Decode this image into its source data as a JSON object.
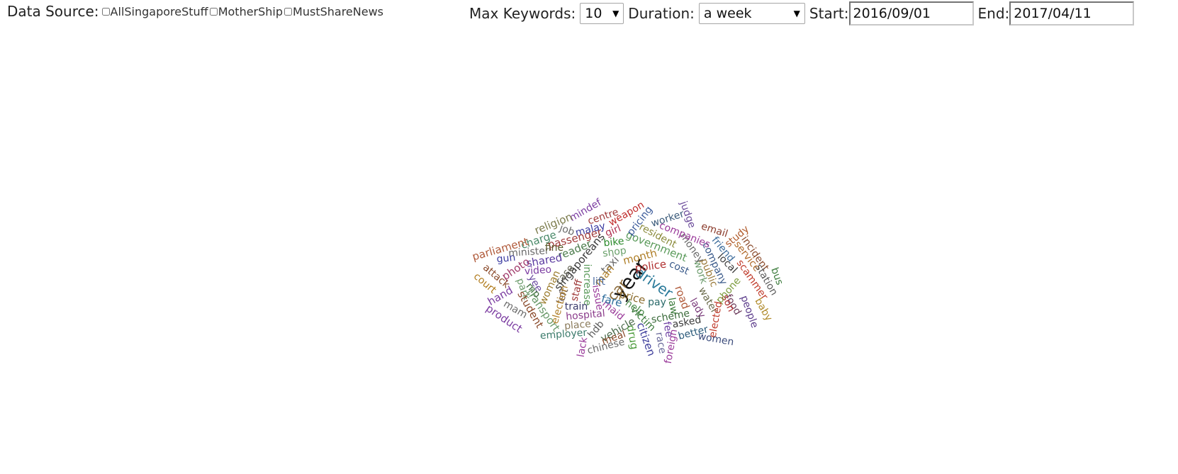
{
  "datasource": {
    "label": "Data Source:",
    "options": [
      {
        "label": "AllSingaporeStuff",
        "checked": false
      },
      {
        "label": "MotherShip",
        "checked": false
      },
      {
        "label": "MustShareNews",
        "checked": false
      }
    ]
  },
  "controls": {
    "max_keywords_label": "Max Keywords:",
    "max_keywords_value": "10",
    "duration_label": "Duration:",
    "duration_value": "a week",
    "start_label": "Start:",
    "start_value": "2016/09/01",
    "end_label": "End:",
    "end_value": "2017/04/11"
  },
  "cloud": {
    "words": [
      "year",
      "driver",
      "car",
      "police",
      "government",
      "pricing",
      "weapon",
      "centre",
      "mindef",
      "religion",
      "job",
      "malay",
      "girl",
      "resident",
      "worker",
      "judge",
      "email",
      "study",
      "incident",
      "service",
      "station",
      "bus",
      "scammer",
      "baby",
      "people",
      "food",
      "son",
      "local",
      "friend",
      "company",
      "phone",
      "public",
      "water",
      "work",
      "money",
      "companies",
      "cost",
      "month",
      "shop",
      "bike",
      "passenger",
      "charge",
      "parliament",
      "gun",
      "minister",
      "fine",
      "reader",
      "shared",
      "video",
      "photo",
      "attack",
      "court",
      "hand",
      "product",
      "mam",
      "park",
      "yee",
      "mp",
      "transport",
      "student",
      "woman",
      "case",
      "singaporeans",
      "taxi",
      "man",
      "lift",
      "increase",
      "issue",
      "maid",
      "fare",
      "price",
      "help",
      "pay",
      "victim",
      "scheme",
      "law",
      "road",
      "lady",
      "elected",
      "asked",
      "fee",
      "better",
      "women",
      "foreign",
      "race",
      "citizen",
      "drug",
      "vehicle",
      "meal",
      "chinese",
      "hdb",
      "lack",
      "employer",
      "place",
      "hospital",
      "train",
      "left",
      "election",
      "staff"
    ]
  }
}
